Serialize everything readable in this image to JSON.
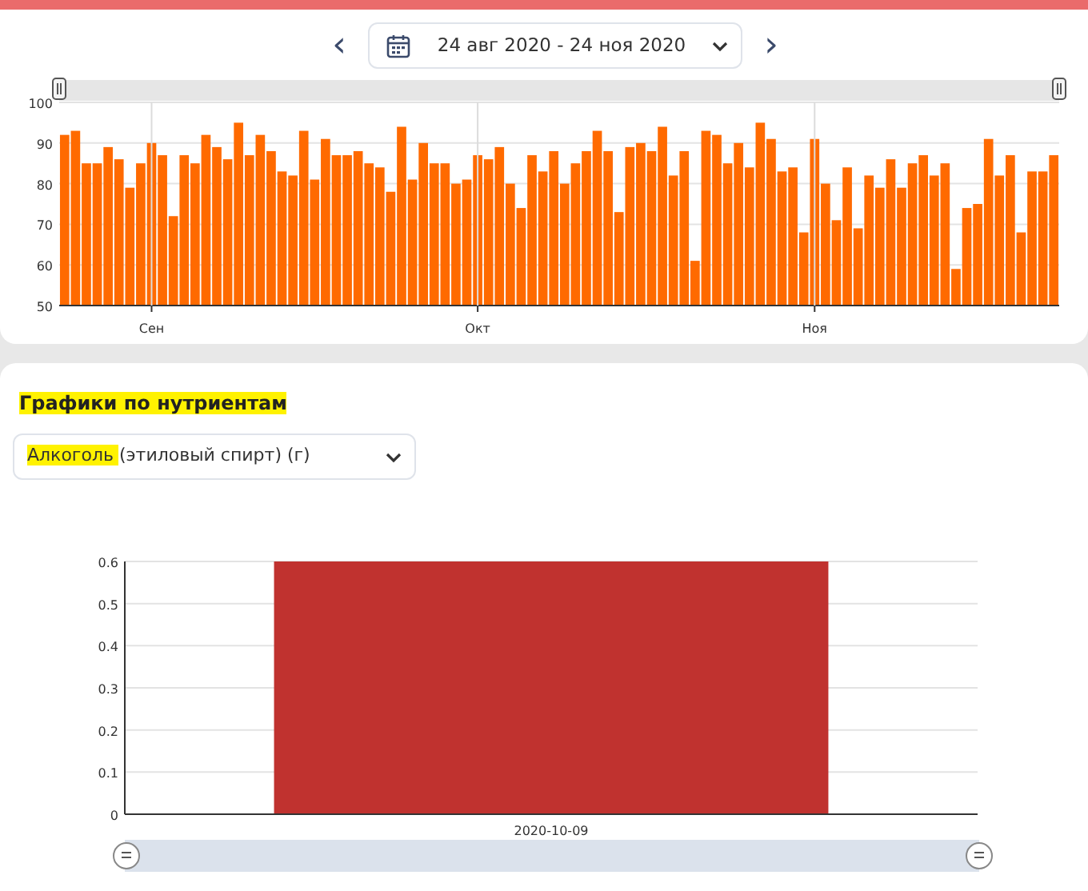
{
  "date_nav": {
    "prev": "‹",
    "range": "24 авг 2020 - 24 ноя 2020",
    "next": "›"
  },
  "daily_chart": {
    "chart_data": {
      "type": "bar",
      "grid": true,
      "categories": [
        null,
        null,
        null,
        null,
        null,
        null,
        null,
        null,
        "Сен",
        null,
        null,
        null,
        null,
        null,
        null,
        null,
        null,
        null,
        null,
        null,
        null,
        null,
        null,
        null,
        null,
        null,
        null,
        null,
        null,
        null,
        null,
        null,
        null,
        null,
        null,
        null,
        null,
        null,
        "Окт",
        null,
        null,
        null,
        null,
        null,
        null,
        null,
        null,
        null,
        null,
        null,
        null,
        null,
        null,
        null,
        null,
        null,
        null,
        null,
        null,
        null,
        null,
        null,
        null,
        null,
        null,
        null,
        null,
        null,
        null,
        "Ноя",
        null,
        null,
        null,
        null,
        null,
        null,
        null,
        null,
        null,
        null,
        null,
        null,
        null,
        null,
        null,
        null,
        null,
        null,
        null,
        null,
        null,
        null
      ],
      "series": [
        {
          "color": "#ff6a00",
          "values": [
            92,
            93,
            85,
            85,
            89,
            86,
            79,
            85,
            90,
            87,
            72,
            87,
            85,
            92,
            89,
            86,
            95,
            87,
            92,
            88,
            83,
            82,
            93,
            81,
            91,
            87,
            87,
            88,
            85,
            84,
            78,
            94,
            81,
            90,
            85,
            85,
            80,
            81,
            87,
            86,
            89,
            80,
            74,
            87,
            83,
            88,
            80,
            85,
            88,
            93,
            88,
            73,
            89,
            90,
            88,
            94,
            82,
            88,
            61,
            93,
            92,
            85,
            90,
            84,
            95,
            91,
            83,
            84,
            68,
            91,
            80,
            71,
            84,
            69,
            82,
            79,
            86,
            79,
            85,
            87,
            82,
            85,
            59,
            74,
            75,
            91,
            82,
            87,
            68,
            83,
            83,
            87
          ]
        }
      ],
      "ylim": [
        50,
        100
      ],
      "yticks": [
        50,
        60,
        70,
        80,
        90,
        100
      ]
    }
  },
  "nutrients": {
    "title": "Графики по нутриентам",
    "title_highlighted": true,
    "select": {
      "value_highlighted_part": "Алкоголь ",
      "value_rest": "(этиловый спирт) (г)"
    },
    "chart_data": {
      "type": "bar",
      "grid": true,
      "categories": [
        "2020-10-09"
      ],
      "series": [
        {
          "color": "#c0322f",
          "values": [
            0.6
          ]
        }
      ],
      "ylim": [
        0,
        0.6
      ],
      "yticks": [
        {
          "value": 0,
          "label": "0"
        },
        {
          "value": 0.1,
          "label": "0.1"
        },
        {
          "value": 0.2,
          "label": "0.2"
        },
        {
          "value": 0.3,
          "label": "0.3"
        },
        {
          "value": 0.4,
          "label": "0.4"
        },
        {
          "value": 0.5,
          "label": "0.5"
        },
        {
          "value": 0.6,
          "label": "0.6"
        }
      ]
    }
  }
}
